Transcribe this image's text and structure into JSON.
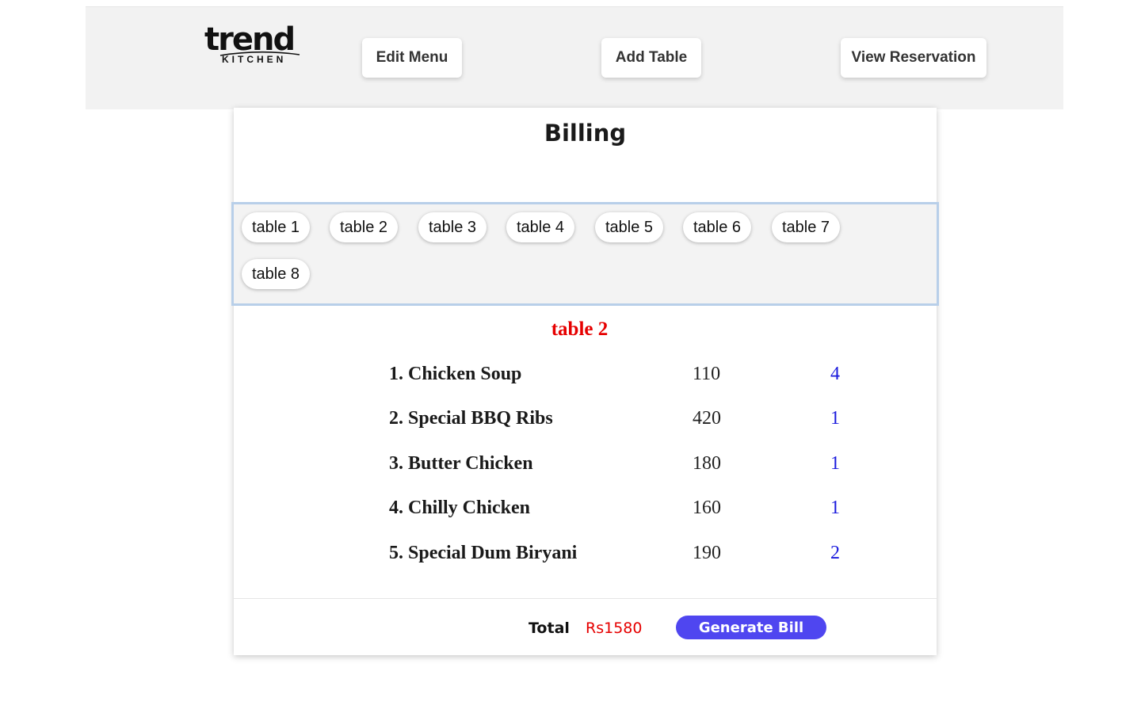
{
  "brand": {
    "name": "trend",
    "sub": "KITCHEN"
  },
  "nav": {
    "edit_menu": "Edit Menu",
    "add_table": "Add Table",
    "view_reservation": "View Reservation"
  },
  "billing": {
    "title": "Billing",
    "tables": [
      "table 1",
      "table 2",
      "table 3",
      "table 4",
      "table 5",
      "table 6",
      "table 7",
      "table 8"
    ],
    "selected_table": "table 2",
    "items": [
      {
        "name": "1. Chicken Soup",
        "price": "110",
        "qty": "4"
      },
      {
        "name": "2. Special BBQ Ribs",
        "price": "420",
        "qty": "1"
      },
      {
        "name": "3. Butter Chicken",
        "price": "180",
        "qty": "1"
      },
      {
        "name": "4. Chilly Chicken",
        "price": "160",
        "qty": "1"
      },
      {
        "name": "5. Special Dum Biryani",
        "price": "190",
        "qty": "2"
      }
    ],
    "total_label": "Total",
    "total_value": "Rs1580",
    "generate_label": "Generate Bill"
  },
  "colors": {
    "accent": "#4f46f0",
    "total": "#e60000",
    "qty": "#1a1add",
    "header_bg": "#f2f2f2"
  }
}
